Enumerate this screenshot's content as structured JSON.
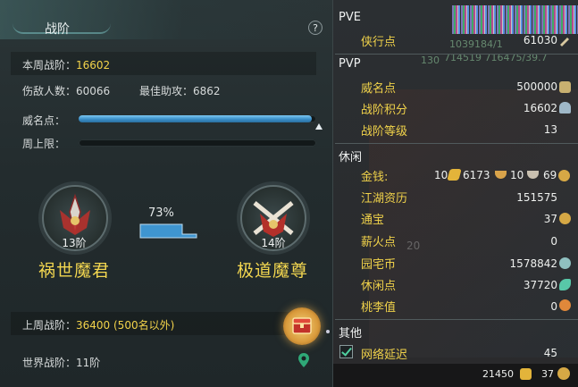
{
  "left_panel": {
    "title": "战阶",
    "help_label": "?",
    "weekly_rank_label": "本周战阶：",
    "weekly_rank_value": "16602",
    "kills_label": "伤敌人数：",
    "kills_value": "60066",
    "best_assist_label": "最佳助攻：",
    "best_assist_value": "6862",
    "prestige_label": "威名点：",
    "prestige_progress": 0.98,
    "weekly_cap_label": "周上限：",
    "weekly_cap_progress": 0,
    "current_rank": {
      "level": "13阶",
      "name": "祸世魔君"
    },
    "next_rank": {
      "level": "14阶",
      "name": "极道魔尊"
    },
    "upgrade_percent": "73%",
    "last_week_label": "上周战阶：",
    "last_week_value": "36400 (500名以外)",
    "world_rank_label": "世界战阶：",
    "world_rank_value": "11阶"
  },
  "right_panel": {
    "top_faint": "1039184/1",
    "top_faint2": "714519 716475/39.7",
    "top_faint3": "130",
    "sections": {
      "pve": "PVE",
      "pvp": "PVP",
      "leisure": "休闲",
      "other": "其他"
    },
    "pve_rows": [
      {
        "label": "侠行点",
        "value": "61030"
      }
    ],
    "pvp_rows": [
      {
        "label": "威名点",
        "value": "500000"
      },
      {
        "label": "战阶积分",
        "value": "16602"
      },
      {
        "label": "战阶等级",
        "value": "13"
      }
    ],
    "money": {
      "label": "金钱:",
      "gold": "10",
      "silver": "6173",
      "copper_a": "10",
      "copper_b": "69"
    },
    "leisure_rows": [
      {
        "label": "江湖资历",
        "value": "151575"
      },
      {
        "label": "通宝",
        "value": "37"
      },
      {
        "label": "薪火点",
        "value": "0"
      },
      {
        "label": "园宅币",
        "value": "1578842"
      },
      {
        "label": "休闲点",
        "value": "37720"
      },
      {
        "label": "桃李值",
        "value": "0"
      }
    ],
    "other_rows": [
      {
        "label": "网络延迟",
        "value": "45",
        "checked": true
      }
    ],
    "bottom_bar": {
      "left_value": "21450",
      "right_value": "37"
    },
    "background_number": "20"
  },
  "colors": {
    "accent_yellow": "#f2d34a",
    "progress_blue": "#3a8fc8",
    "panel_bg": "#232c2e"
  }
}
